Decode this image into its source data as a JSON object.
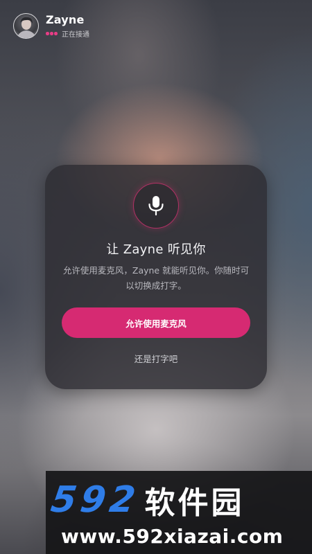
{
  "header": {
    "name": "Zayne",
    "status": "正在接通",
    "icons": {
      "avatar": "user-avatar",
      "status_dots": "connecting-dots-icon"
    }
  },
  "dialog": {
    "icon": "microphone-icon",
    "title": "让 Zayne 听见你",
    "description": "允许使用麦克风，Zayne 就能听见你。你随时可以切换成打字。",
    "allow_button": "允许使用麦克风",
    "type_link": "还是打字吧"
  },
  "watermark": {
    "number": "592",
    "brand": "软件园",
    "url": "www.592xiazai.com"
  },
  "colors": {
    "accent": "#d62a72",
    "status_dot": "#e83d86",
    "watermark_blue": "#2f7de8"
  }
}
